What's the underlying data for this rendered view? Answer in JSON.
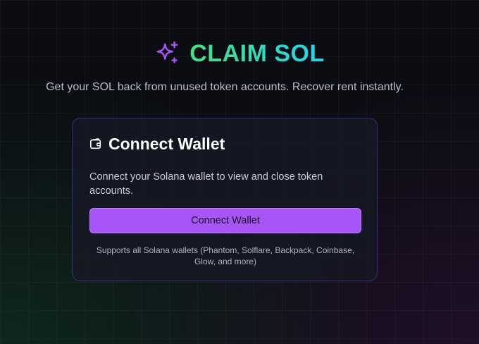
{
  "header": {
    "title": "CLAIM SOL",
    "icon": "sparkles-icon",
    "subtitle": "Get your SOL back from unused token accounts. Recover rent instantly."
  },
  "card": {
    "icon": "wallet-icon",
    "title": "Connect Wallet",
    "description": "Connect your Solana wallet to view and close token accounts.",
    "button_label": "Connect Wallet",
    "support_text": "Supports all Solana wallets (Phantom, Solflare, Backpack, Coinbase, Glow, and more)"
  },
  "colors": {
    "accent": "#a855f7",
    "title_gradient_start": "#4ade80",
    "title_gradient_end": "#22d3ee",
    "background": "#0b0d12"
  }
}
